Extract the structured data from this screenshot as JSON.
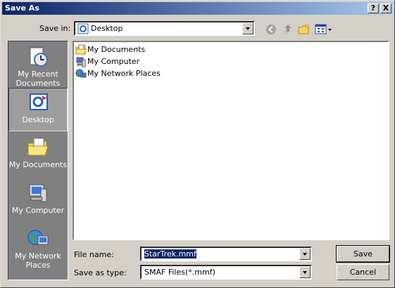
{
  "window": {
    "title": "Save As",
    "help_label": "?",
    "close_label": "X"
  },
  "savein": {
    "label": "Save in:",
    "value": "Desktop"
  },
  "toolbar": {
    "back_icon": "back-arrow-icon",
    "up_icon": "up-folder-icon",
    "new_folder_icon": "new-folder-icon",
    "views_icon": "views-menu-icon"
  },
  "sidebar": {
    "items": [
      {
        "label": "My Recent Documents",
        "icon": "recent-documents-icon"
      },
      {
        "label": "Desktop",
        "icon": "desktop-icon"
      },
      {
        "label": "My Documents",
        "icon": "my-documents-icon"
      },
      {
        "label": "My Computer",
        "icon": "my-computer-icon"
      },
      {
        "label": "My Network Places",
        "icon": "network-places-icon"
      }
    ]
  },
  "files": [
    {
      "name": "My Documents",
      "icon": "folder-icon"
    },
    {
      "name": "My Computer",
      "icon": "computer-icon"
    },
    {
      "name": "My Network Places",
      "icon": "network-icon"
    }
  ],
  "filename": {
    "label": "File name:",
    "value": "StarTrek.mmf"
  },
  "filetype": {
    "label": "Save as type:",
    "value": "SMAF Files(*.mmf)"
  },
  "buttons": {
    "save": "Save",
    "cancel": "Cancel"
  },
  "colors": {
    "titlebar_start": "#0a246a",
    "titlebar_end": "#a6caf0",
    "face": "#d4d0c8",
    "sidebar": "#808080"
  }
}
